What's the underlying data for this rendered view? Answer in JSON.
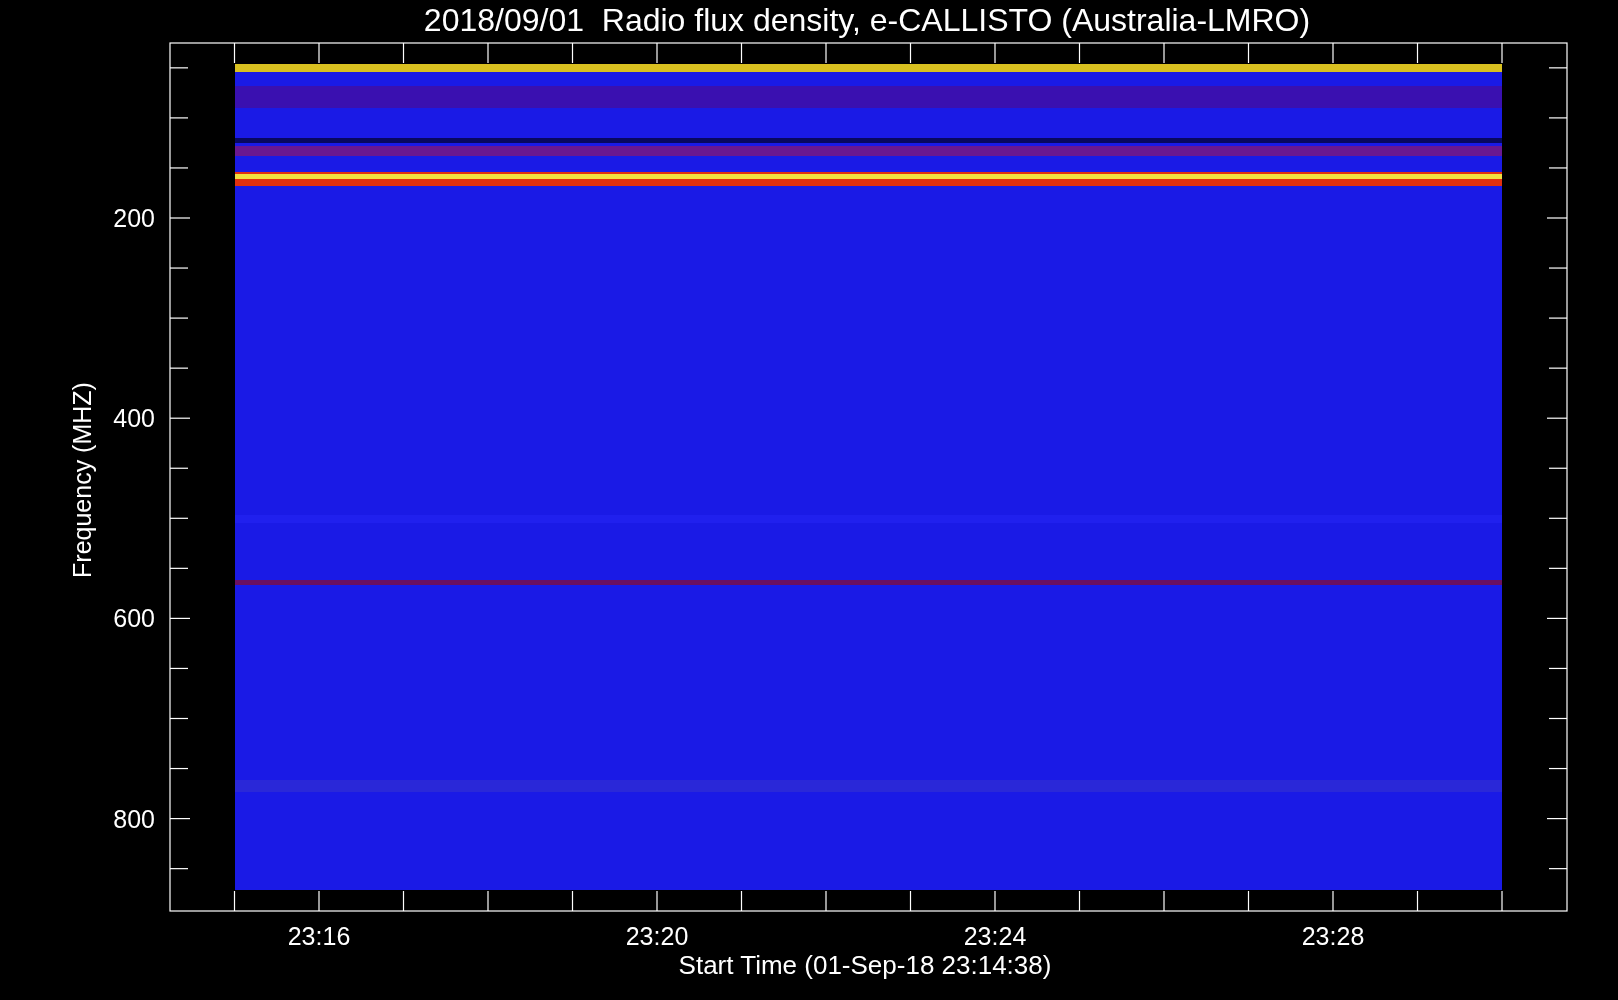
{
  "title": "2018/09/01  Radio flux density, e-CALLISTO (Australia-LMRO)",
  "plot": {
    "ylabel": "Frequency (MHZ)",
    "yticks": [
      "200",
      "400",
      "600",
      "800"
    ],
    "xticks": [
      "23:16",
      "23:20",
      "23:24",
      "23:28"
    ],
    "xlabel": "Start Time (01-Sep-18 23:14:38)"
  }
}
